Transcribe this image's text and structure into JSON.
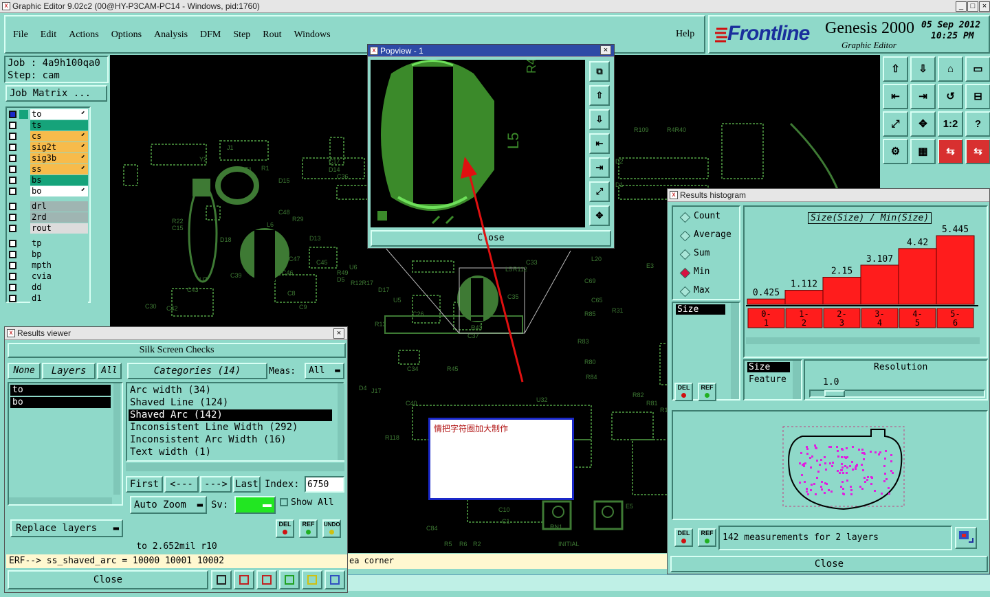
{
  "app": {
    "title": "Graphic Editor 9.02c2 (00@HY-P3CAM-PC14 - Windows, pid:1760)"
  },
  "menu": {
    "items": [
      "File",
      "Edit",
      "Actions",
      "Options",
      "Analysis",
      "DFM",
      "Step",
      "Rout",
      "Windows"
    ],
    "help": "Help"
  },
  "brand": {
    "logo": "Frontline",
    "product": "Genesis 2000",
    "subtitle": "Graphic Editor",
    "date": "05 Sep 2012",
    "time": "10:25 PM"
  },
  "job": {
    "job": "Job : 4a9h100qa0",
    "step": "Step: cam",
    "matrix_button": "Job Matrix ..."
  },
  "layers": [
    {
      "name": "to",
      "color": "#ffffff",
      "dot": true
    },
    {
      "name": "ts",
      "color": "#16a37a",
      "dot": false
    },
    {
      "name": "cs",
      "color": "#f7bb4b",
      "dot": true
    },
    {
      "name": "sig2t",
      "color": "#f7bb4b",
      "dot": true
    },
    {
      "name": "sig3b",
      "color": "#f7bb4b",
      "dot": true
    },
    {
      "name": "ss",
      "color": "#f7bb4b",
      "dot": true
    },
    {
      "name": "bs",
      "color": "#16a37a",
      "dot": false
    },
    {
      "name": "bo",
      "color": "#ffffff",
      "dot": true
    },
    {
      "name": "drl",
      "color": "#9fb5b2",
      "dot": false
    },
    {
      "name": "2rd",
      "color": "#9fb5b2",
      "dot": false
    },
    {
      "name": "rout",
      "color": "#dcdcdc",
      "dot": false
    },
    {
      "name": "tp",
      "color": "#8fd9c9",
      "dot": false
    },
    {
      "name": "bp",
      "color": "#8fd9c9",
      "dot": false
    },
    {
      "name": "mpth",
      "color": "#8fd9c9",
      "dot": false
    },
    {
      "name": "cvia",
      "color": "#8fd9c9",
      "dot": false
    },
    {
      "name": "dd",
      "color": "#8fd9c9",
      "dot": false
    },
    {
      "name": "d1",
      "color": "#8fd9c9",
      "dot": false
    }
  ],
  "popview": {
    "title": "Popview - 1",
    "close": "Close",
    "label_l5": "L5",
    "label_r4": "R4"
  },
  "annotation": {
    "text": "情把字符圈加大制作"
  },
  "results_viewer": {
    "title": "Results viewer",
    "heading": "Silk Screen Checks",
    "none_btn": "None",
    "layers_btn": "Layers",
    "all_btn": "All",
    "categories_btn": "Categories (14)",
    "meas_label": "Meas:",
    "meas_value": "All",
    "layers_list": [
      "to",
      "bo"
    ],
    "categories": [
      "Arc width (34)",
      "Shaved Line (124)",
      "Shaved Arc (142)",
      "Inconsistent Line Width (292)",
      "Inconsistent Arc Width (16)",
      "Text width (1)"
    ],
    "selected_category": "Shaved Arc (142)",
    "first": "First",
    "prev": "<---",
    "next": "--->",
    "last": "Last",
    "index_label": "Index:",
    "index_value": "6750",
    "auto_zoom": "Auto Zoom",
    "sv_label": "Sv:",
    "show_all": "Show All",
    "replace_layers": "Replace layers",
    "status": "to 2.652mil r10",
    "erf": "ERF--> ss_shaved_arc = 10000 10001 10002",
    "close": "Close",
    "del": "DEL",
    "ref": "REF",
    "undo": "UNDO"
  },
  "status_bar": {
    "text": "ea corner"
  },
  "histogram": {
    "title": "Results histogram",
    "modes": [
      "Count",
      "Average",
      "Sum",
      "Min",
      "Max"
    ],
    "selected_mode": "Min",
    "field": "Size",
    "chart_title": "Size(Size) / Min(Size)",
    "size_label": "Size",
    "feature_label": "Feature",
    "resolution_label": "Resolution",
    "resolution_value": "1.0",
    "measurements": "142 measurements for 2 layers",
    "close": "Close",
    "del": "DEL",
    "ref": "REF"
  },
  "chart_data": {
    "type": "bar",
    "title": "Size(Size) / Min(Size)",
    "categories": [
      "0-1",
      "1-2",
      "2-3",
      "3-4",
      "4-5",
      "5-6"
    ],
    "values": [
      0.425,
      1.112,
      2.15,
      3.107,
      4.42,
      5.445
    ],
    "ylim": [
      0,
      5.445
    ],
    "bar_color": "#ff1c1c"
  },
  "pcb_labels": [
    "J1",
    "Y2",
    "BT1",
    "R1",
    "D15",
    "C17",
    "D14",
    "C36",
    "R22",
    "C15",
    "L6",
    "D18",
    "C39",
    "U7",
    "C42",
    "C43",
    "C45",
    "R49",
    "D5",
    "R12R17",
    "D17",
    "U5",
    "C26",
    "C34",
    "R45",
    "R43",
    "C37",
    "C35",
    "L5",
    "C33",
    "L20",
    "C69",
    "C65",
    "R85",
    "R83",
    "R80",
    "R84",
    "R82",
    "R81",
    "U32",
    "D4",
    "J17",
    "C84",
    "R118",
    "C10",
    "C1",
    "RN1",
    "INITIAL",
    "R5",
    "R6",
    "R2",
    "R112",
    "R109",
    "R4R40",
    "D2",
    "D1",
    "R31",
    "R116",
    "C9",
    "C8",
    "C46",
    "C47",
    "C48",
    "R29",
    "D13",
    "U6",
    "E3",
    "E5",
    "R13",
    "C40",
    "L2",
    "A",
    "Z5",
    "C30"
  ]
}
